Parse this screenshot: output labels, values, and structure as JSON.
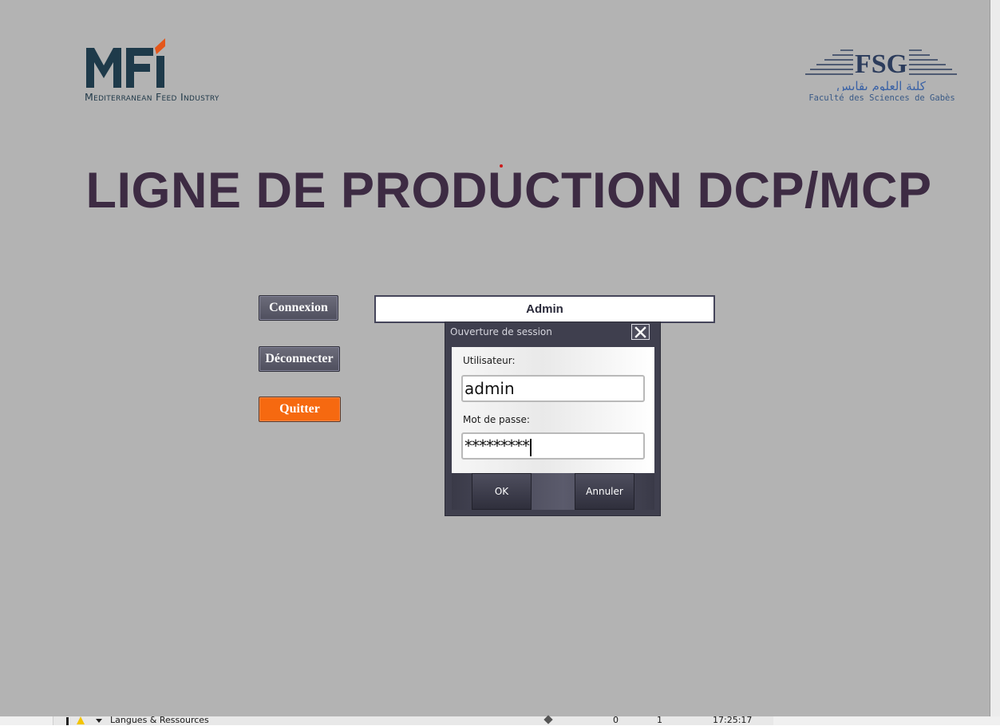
{
  "logos": {
    "left": {
      "mark": "MFI",
      "subtitle": "Mediterranean Feed Industry",
      "colors": {
        "letters": "#1e3a4a",
        "accent": "#e4571b"
      }
    },
    "right": {
      "mark": "FSG",
      "arabic": "كلية العلوم بقابس",
      "caption": "Faculté des Sciences de Gabès",
      "colors": {
        "mark": "#2c3c5c",
        "arabic": "#3a62a6"
      }
    }
  },
  "main_title": "LIGNE DE PRODUCTION DCP/MCP",
  "buttons": {
    "connexion": "Connexion",
    "deconnecter": "Déconnecter",
    "quitter": "Quitter"
  },
  "current_user": "Admin",
  "login_dialog": {
    "title": "Ouverture de session",
    "user_label": "Utilisateur:",
    "user_value": "admin",
    "password_label": "Mot de passe:",
    "password_value": "*********",
    "ok_label": "OK",
    "cancel_label": "Annuler"
  },
  "taskbar": {
    "text": "Langues & Ressources",
    "count_a": "0",
    "count_b": "1",
    "time": "17:25:17"
  },
  "colors": {
    "background": "#b3b3b3",
    "title": "#3d2b43",
    "button": "#5a5a6a",
    "quit_button": "#f66910",
    "dialog": "#3f3f4e"
  }
}
